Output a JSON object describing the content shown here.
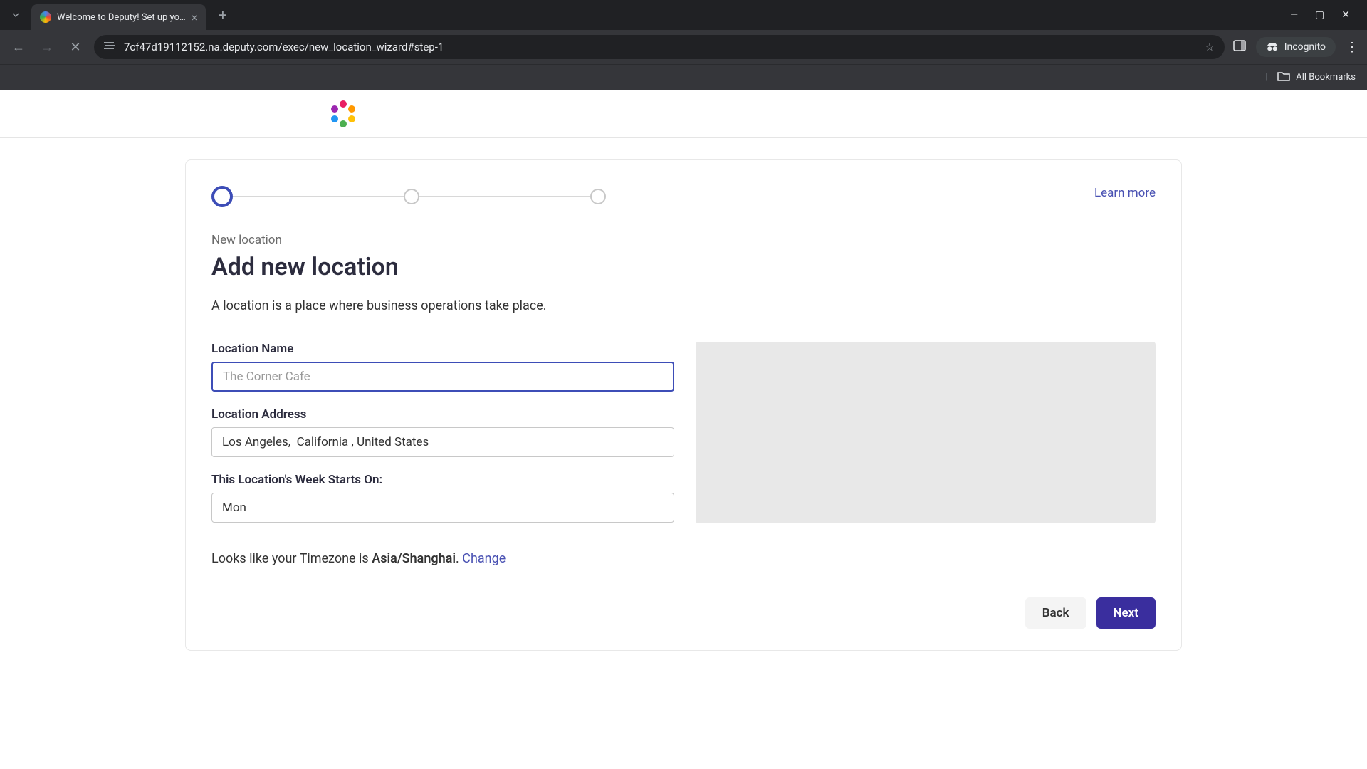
{
  "browser": {
    "tab_title": "Welcome to Deputy! Set up yo…",
    "url": "7cf47d19112152.na.deputy.com/exec/new_location_wizard#step-1",
    "incognito_label": "Incognito",
    "bookmarks_label": "All Bookmarks"
  },
  "page": {
    "learn_more": "Learn more",
    "breadcrumb": "New location",
    "title": "Add new location",
    "description": "A location is a place where business operations take place."
  },
  "form": {
    "name_label": "Location Name",
    "name_placeholder": "The Corner Cafe",
    "name_value": "",
    "address_label": "Location Address",
    "address_value": "Los Angeles,  California , United States",
    "week_label": "This Location's Week Starts On:",
    "week_value": "Mon"
  },
  "timezone": {
    "prefix": "Looks like your Timezone is ",
    "value": "Asia/Shanghai",
    "suffix": ". ",
    "change": "Change"
  },
  "buttons": {
    "back": "Back",
    "next": "Next"
  }
}
